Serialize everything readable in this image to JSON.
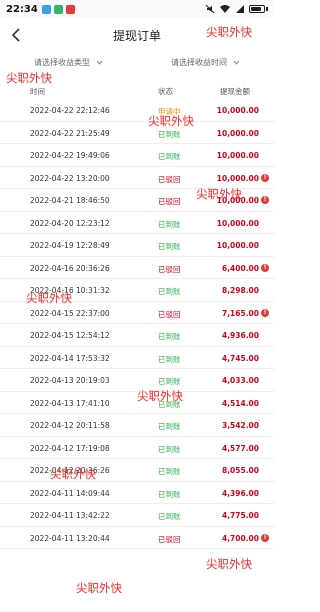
{
  "status_bar": {
    "time": "22:34",
    "battery": 0.8
  },
  "nav": {
    "title": "提现订单"
  },
  "filters": [
    {
      "label": "请选择收益类型"
    },
    {
      "label": "请选择收益时间"
    }
  ],
  "table": {
    "headers": {
      "time": "时间",
      "status": "状态",
      "amount": "提现金额"
    },
    "rows": [
      {
        "time": "2022-04-22 22:12:46",
        "status": "申请中",
        "status_type": "pending",
        "amount": "10,000.00",
        "info": false
      },
      {
        "time": "2022-04-22 21:25:49",
        "status": "已到账",
        "status_type": "done",
        "amount": "10,000.00",
        "info": false
      },
      {
        "time": "2022-04-22 19:49:06",
        "status": "已到账",
        "status_type": "done",
        "amount": "10,000.00",
        "info": false
      },
      {
        "time": "2022-04-22 13:20:00",
        "status": "已驳回",
        "status_type": "rejected",
        "amount": "10,000.00",
        "info": true
      },
      {
        "time": "2022-04-21 18:46:50",
        "status": "已驳回",
        "status_type": "rejected",
        "amount": "10,000.00",
        "info": true
      },
      {
        "time": "2022-04-20 12:23:12",
        "status": "已到账",
        "status_type": "done",
        "amount": "10,000.00",
        "info": false
      },
      {
        "time": "2022-04-19 12:28:49",
        "status": "已到账",
        "status_type": "done",
        "amount": "10,000.00",
        "info": false
      },
      {
        "time": "2022-04-16 20:36:26",
        "status": "已驳回",
        "status_type": "rejected",
        "amount": "6,400.00",
        "info": true
      },
      {
        "time": "2022-04-16 10:31:32",
        "status": "已到账",
        "status_type": "done",
        "amount": "8,298.00",
        "info": false
      },
      {
        "time": "2022-04-15 22:37:00",
        "status": "已驳回",
        "status_type": "rejected",
        "amount": "7,165.00",
        "info": true
      },
      {
        "time": "2022-04-15 12:54:12",
        "status": "已到账",
        "status_type": "done",
        "amount": "4,936.00",
        "info": false
      },
      {
        "time": "2022-04-14 17:53:32",
        "status": "已到账",
        "status_type": "done",
        "amount": "4,745.00",
        "info": false
      },
      {
        "time": "2022-04-13 20:19:03",
        "status": "已到账",
        "status_type": "done",
        "amount": "4,033.00",
        "info": false
      },
      {
        "time": "2022-04-13 17:41:10",
        "status": "已到账",
        "status_type": "done",
        "amount": "4,514.00",
        "info": false
      },
      {
        "time": "2022-04-12 20:11:58",
        "status": "已到账",
        "status_type": "done",
        "amount": "3,542.00",
        "info": false
      },
      {
        "time": "2022-04-12 17:19:08",
        "status": "已到账",
        "status_type": "done",
        "amount": "4,577.00",
        "info": false
      },
      {
        "time": "2022-04-12 20:36:26",
        "status": "已到账",
        "status_type": "done",
        "amount": "8,055.00",
        "info": false
      },
      {
        "time": "2022-04-11 14:09:44",
        "status": "已到账",
        "status_type": "done",
        "amount": "4,396.00",
        "info": false
      },
      {
        "time": "2022-04-11 13:42:22",
        "status": "已到账",
        "status_type": "done",
        "amount": "4,775.00",
        "info": false
      },
      {
        "time": "2022-04-11 13:20:44",
        "status": "已驳回",
        "status_type": "rejected",
        "amount": "4,700.00",
        "info": true
      }
    ]
  },
  "watermark": "尖职外快",
  "colors": {
    "done": "#2bb24c",
    "pending": "#f08c00",
    "rejected": "#d9001b",
    "amount": "#d9001b"
  }
}
